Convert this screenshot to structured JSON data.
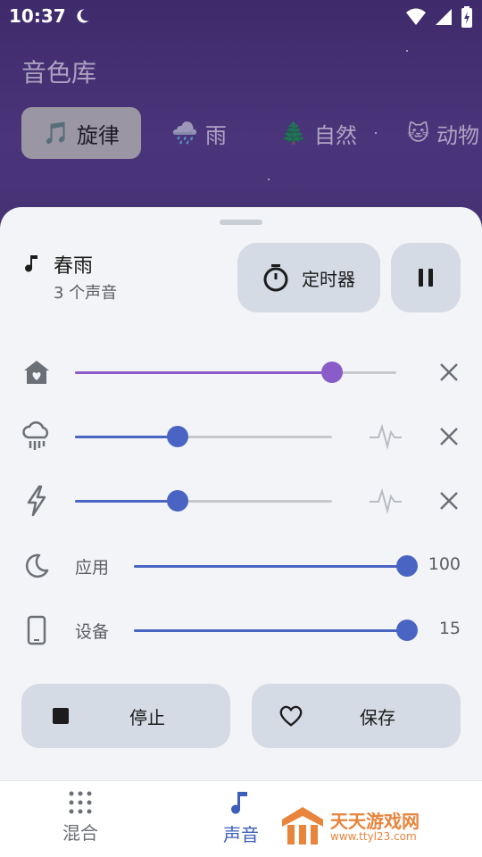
{
  "status": {
    "time": "10:37"
  },
  "header": {
    "title": "音色库"
  },
  "tabs": [
    {
      "emoji": "🎵",
      "label": "旋律",
      "active": true
    },
    {
      "emoji": "🌧️",
      "label": "雨",
      "active": false
    },
    {
      "emoji": "🌲",
      "label": "自然",
      "active": false
    },
    {
      "emoji": "🐱",
      "label": "动物",
      "active": false
    }
  ],
  "now_playing": {
    "title": "春雨",
    "subtitle": "3 个声音",
    "timer_label": "定时器"
  },
  "sounds": [
    {
      "icon": "house-heart-icon",
      "level": 0.8,
      "color": "#8a5cc9"
    },
    {
      "icon": "rain-cloud-icon",
      "level": 0.4,
      "color": "#4a64c4"
    },
    {
      "icon": "lightning-icon",
      "level": 0.4,
      "color": "#4a64c4"
    }
  ],
  "volumes": [
    {
      "icon": "moon-icon",
      "label": "应用",
      "value": "100",
      "level": 1.0
    },
    {
      "icon": "phone-icon",
      "label": "设备",
      "value": "15",
      "level": 1.0
    }
  ],
  "actions": {
    "stop_label": "停止",
    "save_label": "保存"
  },
  "nav": {
    "mix_label": "混合",
    "sound_label": "声音"
  },
  "watermark": {
    "text": "天天游戏网",
    "url": "www.ttyl23.com"
  },
  "colors": {
    "accent": "#4a64c4",
    "accent_purple": "#8a5cc9",
    "header_bg": "#45307a"
  }
}
